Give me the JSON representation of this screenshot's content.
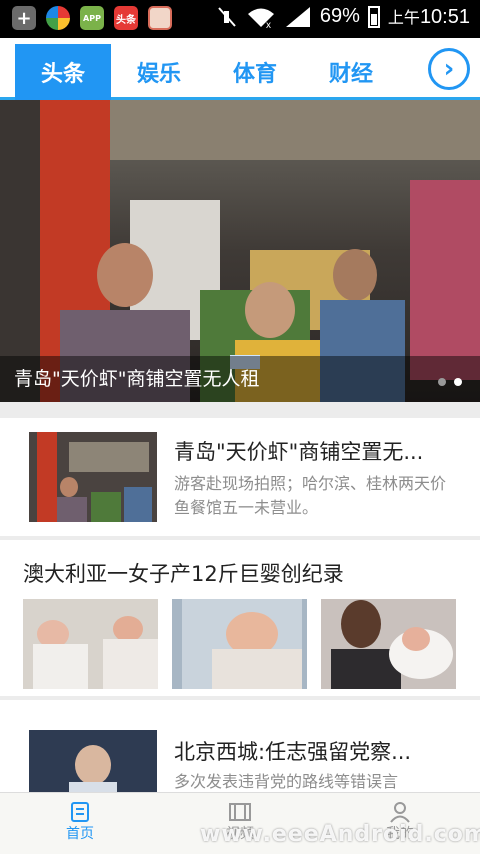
{
  "status_bar": {
    "battery": "69%",
    "ampm": "上午",
    "time": "10:51",
    "app_icons": [
      {
        "name": "plus-icon",
        "label": "+",
        "color": "#6b6b6b"
      },
      {
        "name": "colorful-app-icon",
        "label": "",
        "color": "#3aa14b"
      },
      {
        "name": "app-store-icon",
        "label": "APP",
        "color": "#7bb24a"
      },
      {
        "name": "toutiao-icon",
        "label": "头条",
        "color": "#e53935"
      },
      {
        "name": "avatar-app-icon",
        "label": "",
        "color": "#d86c5a"
      }
    ]
  },
  "tabs": [
    "头条",
    "娱乐",
    "体育",
    "财经"
  ],
  "hero": {
    "caption": "青岛\"天价虾\"商铺空置无人租"
  },
  "articles": [
    {
      "title": "青岛\"天价虾\"商铺空置无...",
      "desc": "游客赴现场拍照；哈尔滨、桂林两天价鱼餐馆五一未营业。"
    },
    {
      "title": "澳大利亚一女子产12斤巨婴创纪录"
    },
    {
      "title": "北京西城:任志强留党察...",
      "desc": "多次发表违背党的路线等错误言"
    }
  ],
  "bottom_nav": [
    "首页",
    "视频",
    "我的"
  ],
  "watermark": "www.eeeAndroid.com",
  "colors": {
    "accent": "#2196f3",
    "statusbar": "#000000"
  }
}
